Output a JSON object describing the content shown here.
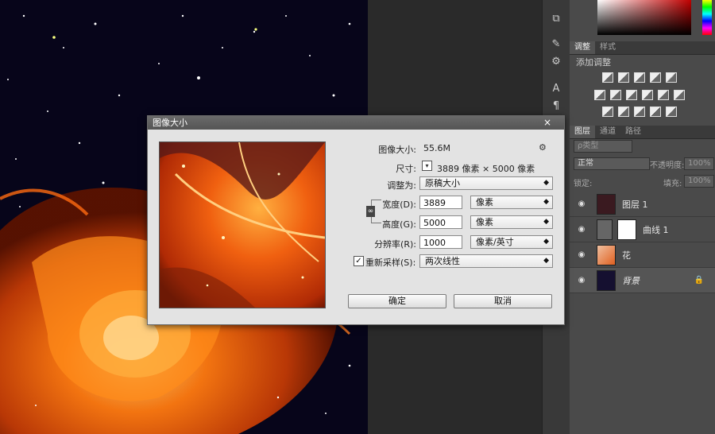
{
  "layers_panel": {
    "tabs": [
      "图层",
      "通道",
      "路径"
    ],
    "filter_label": "ρ类型",
    "blend_mode": "正常",
    "opacity_label": "不透明度:",
    "opacity_value": "100%",
    "lock_label": "锁定:",
    "fill_label": "填充:",
    "fill_value": "100%",
    "layers": [
      {
        "name": "图层 1"
      },
      {
        "name": "曲线 1"
      },
      {
        "name": "花"
      },
      {
        "name": "背景"
      }
    ]
  },
  "adjust_panel": {
    "tabs": [
      "调整",
      "样式"
    ],
    "title": "添加调整"
  },
  "dialog": {
    "title": "图像大小",
    "close": "×",
    "image_size_label": "图像大小:",
    "image_size_value": "55.6M",
    "dimensions_label": "尺寸:",
    "dimensions_value": "3889 像素 × 5000 像素",
    "fit_label": "调整为:",
    "fit_value": "原稿大小",
    "width_label": "宽度(D):",
    "width_value": "3889",
    "width_unit": "像素",
    "height_label": "高度(G):",
    "height_value": "5000",
    "height_unit": "像素",
    "resolution_label": "分辨率(R):",
    "resolution_value": "1000",
    "resolution_unit": "像素/英寸",
    "resample_label": "重新采样(S):",
    "resample_checked": true,
    "resample_value": "两次线性",
    "ok": "确定",
    "cancel": "取消"
  },
  "colors": {
    "dialog_bg": "#e3e3e3",
    "panel_bg": "#4a4a4a",
    "canvas_bg": "#07051a",
    "flower": "#e65a10"
  }
}
